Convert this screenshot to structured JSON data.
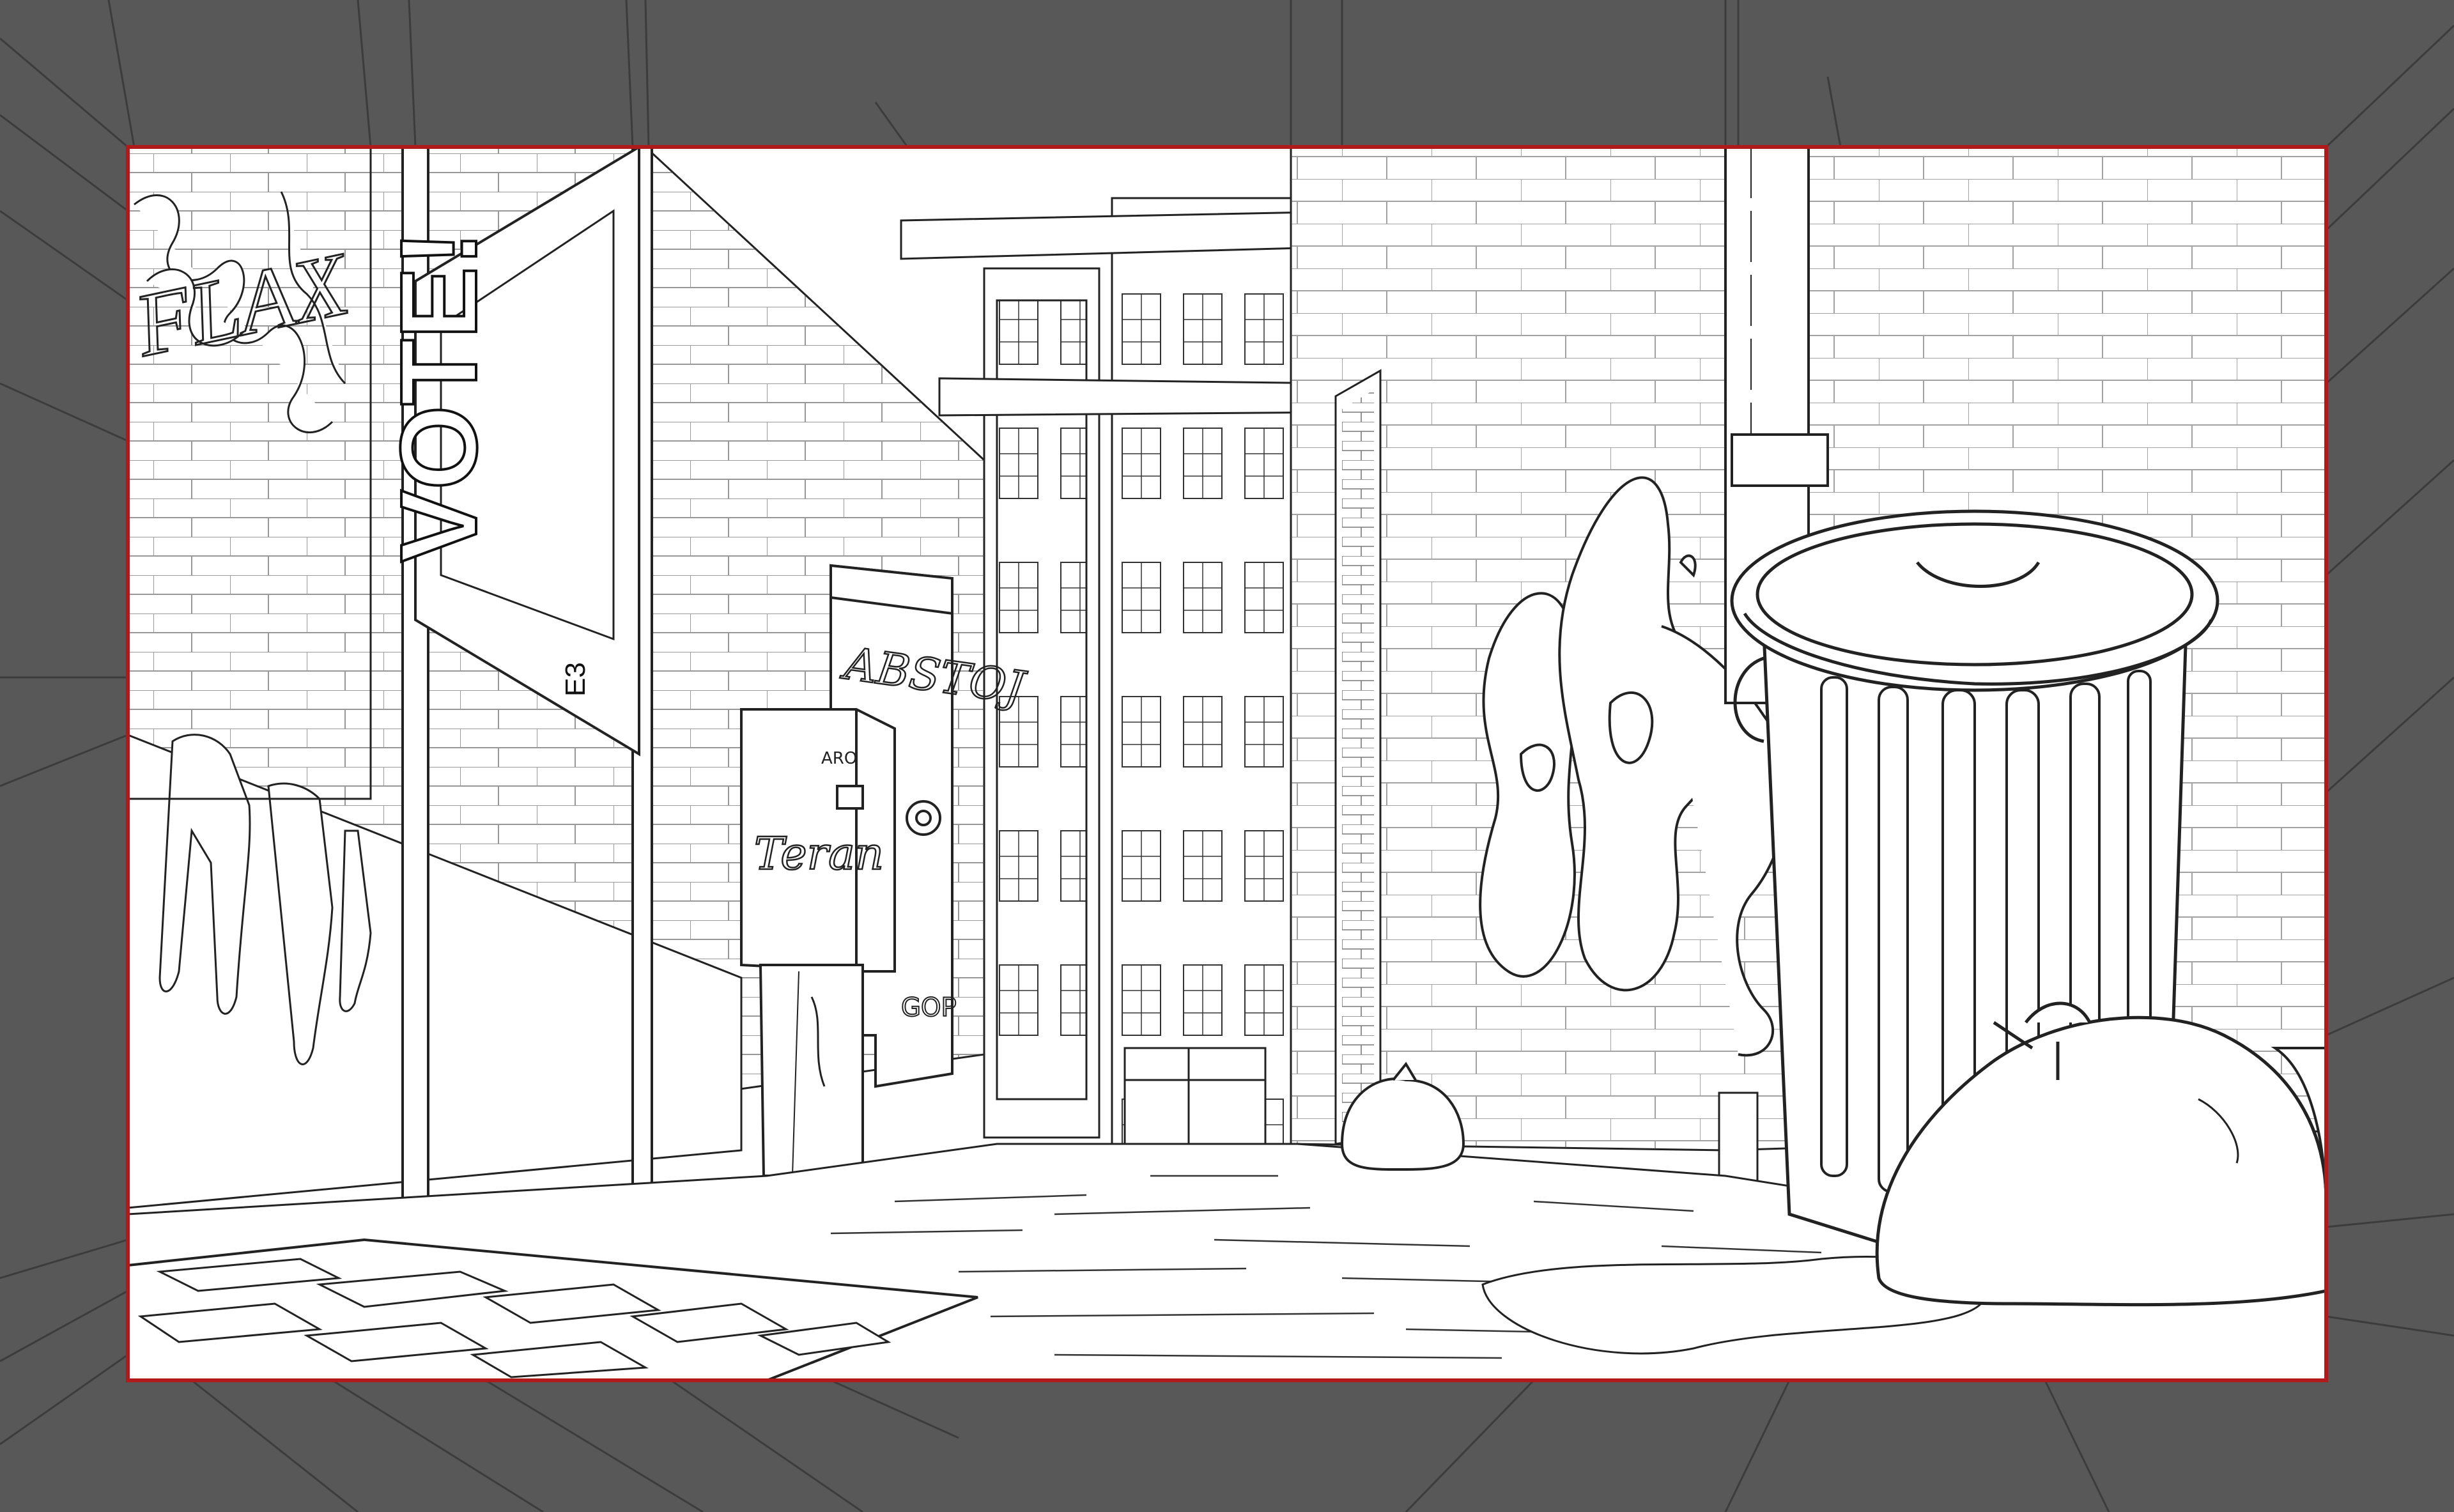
{
  "canvas": {
    "outer_color": "#585858",
    "frame_color": "#b11a1a",
    "paper_color": "#ffffff",
    "line_color": "#1a1a1a"
  },
  "scene": {
    "sign_text": "VOTE!",
    "sign_tag": "E3",
    "tags": {
      "left_wall": "FLAX",
      "box_top": "ABSTOJ",
      "box_small": "ARO",
      "box_graffiti": "Teran",
      "box_bottom": "GOP"
    }
  }
}
